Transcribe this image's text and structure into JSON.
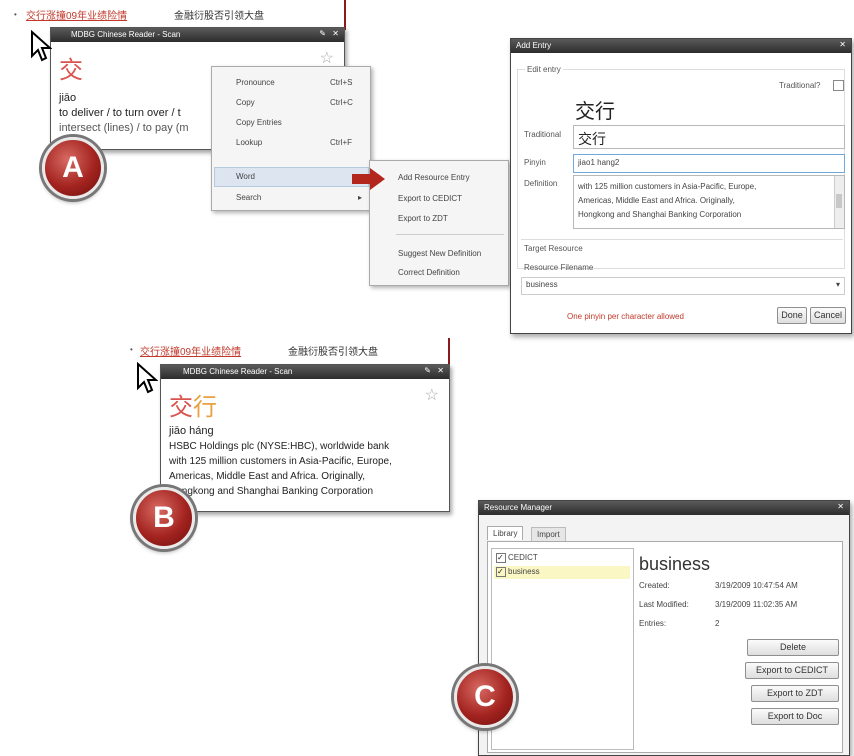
{
  "browser_line_top": {
    "link": "交行涨撞09年业绩险情",
    "rest": "金融衍股否引领大盘"
  },
  "browser_line_mid": {
    "link": "交行涨撞09年业绩险情",
    "rest": "金融衍股否引领大盘"
  },
  "popup_a": {
    "title": "MDBG Chinese Reader - Scan",
    "hanzi": "交",
    "pinyin": "jiāo",
    "definition_lines": [
      "to deliver / to turn over / t",
      "intersect (lines) / to pay (m"
    ]
  },
  "context_menu": {
    "items": [
      {
        "label": "Pronounce",
        "shortcut": "Ctrl+S"
      },
      {
        "label": "Copy",
        "shortcut": "Ctrl+C"
      },
      {
        "label": "Copy Entries",
        "shortcut": ""
      },
      {
        "label": "Lookup",
        "shortcut": "Ctrl+F"
      },
      {
        "label": "Word",
        "shortcut": ""
      },
      {
        "label": "Search",
        "shortcut": "▸"
      }
    ]
  },
  "submenu": {
    "items": [
      "Add Resource Entry",
      "Export to CEDICT",
      "Export to ZDT",
      "Suggest New Definition",
      "Correct Definition"
    ]
  },
  "add_entry": {
    "title": "Add Entry",
    "group_label": "Edit entry",
    "traditional_check_label": "Traditional?",
    "headword": "交行",
    "traditional_label": "Traditional",
    "traditional_value": "交行",
    "pinyin_label": "Pinyin",
    "pinyin_value": "jiao1 hang2",
    "definition_label": "Definition",
    "definition_lines": [
      "with 125 million customers in Asia-Pacific, Europe,",
      "Americas, Middle East and Africa. Originally,",
      "Hongkong and Shanghai Banking Corporation"
    ],
    "target_label": "Target Resource",
    "filename_label": "Resource Filename",
    "filename_value": "business",
    "warning": "One pinyin per character allowed",
    "done": "Done",
    "cancel": "Cancel"
  },
  "popup_b": {
    "title": "MDBG Chinese Reader - Scan",
    "hanzi": "交行",
    "pinyin": "jiāo háng",
    "definition_lines": [
      "HSBC Holdings plc (NYSE:HBC), worldwide bank",
      "with 125 million customers in Asia-Pacific, Europe,",
      "Americas, Middle East and Africa. Originally,",
      "Hongkong and Shanghai Banking Corporation"
    ]
  },
  "resource_manager": {
    "title": "Resource Manager",
    "tabs": [
      "Library",
      "Import"
    ],
    "libraries": [
      "CEDICT",
      "business"
    ],
    "selected_name": "business",
    "created_label": "Created:",
    "created_value": "3/19/2009 10:47:54 AM",
    "modified_label": "Last Modified:",
    "modified_value": "3/19/2009 11:02:35 AM",
    "entries_label": "Entries:",
    "entries_value": "2",
    "buttons": [
      "Delete",
      "Export to CEDICT",
      "Export to ZDT",
      "Export to Doc"
    ]
  },
  "badges": [
    "A",
    "B",
    "C"
  ],
  "colors": {
    "accent_red": "#b3261e",
    "title_bar": "#3a3a3a",
    "hanzi_red": "#d9534f",
    "hanzi_orange": "#e8a040"
  }
}
